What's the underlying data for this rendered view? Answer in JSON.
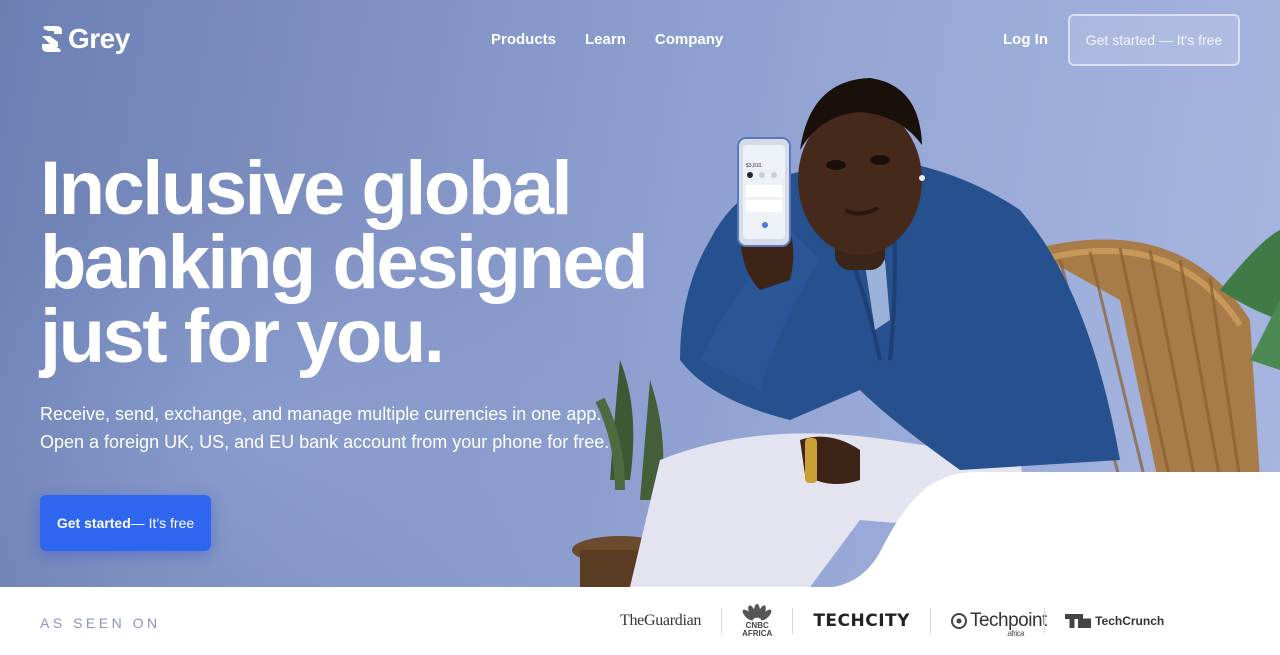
{
  "brand": {
    "name": "Grey"
  },
  "nav": {
    "links": [
      "Products",
      "Learn",
      "Company"
    ],
    "login_label": "Log In",
    "cta_label": "Get started — It's free"
  },
  "hero": {
    "headline": "Inclusive global banking designed just for you.",
    "sub_line1": "Receive, send, exchange, and manage multiple currencies in one app.",
    "sub_line2": "Open a foreign UK, US, and EU bank account from your phone for free.",
    "cta_strong": "Get started",
    "cta_light": "— It's free"
  },
  "press": {
    "label": "AS SEEN ON",
    "outlets": {
      "guardian": "TheGuardian",
      "cnbc_line1": "CNBC",
      "cnbc_line2": "AFRICA",
      "techcity": "TECHCITY",
      "techpoint": "Techpoint",
      "techpoint_suffix": ".africa",
      "techcrunch": "TechCrunch"
    }
  },
  "phone": {
    "balance": "$3,810."
  },
  "colors": {
    "primary": "#2f66f0",
    "hero_bg": "#8193c4",
    "text_on_hero": "#ffffff",
    "muted": "#8a96b8"
  },
  "icons": [
    "grey-logo-icon",
    "cnbc-peacock-icon",
    "techpoint-icon",
    "techcrunch-icon"
  ]
}
